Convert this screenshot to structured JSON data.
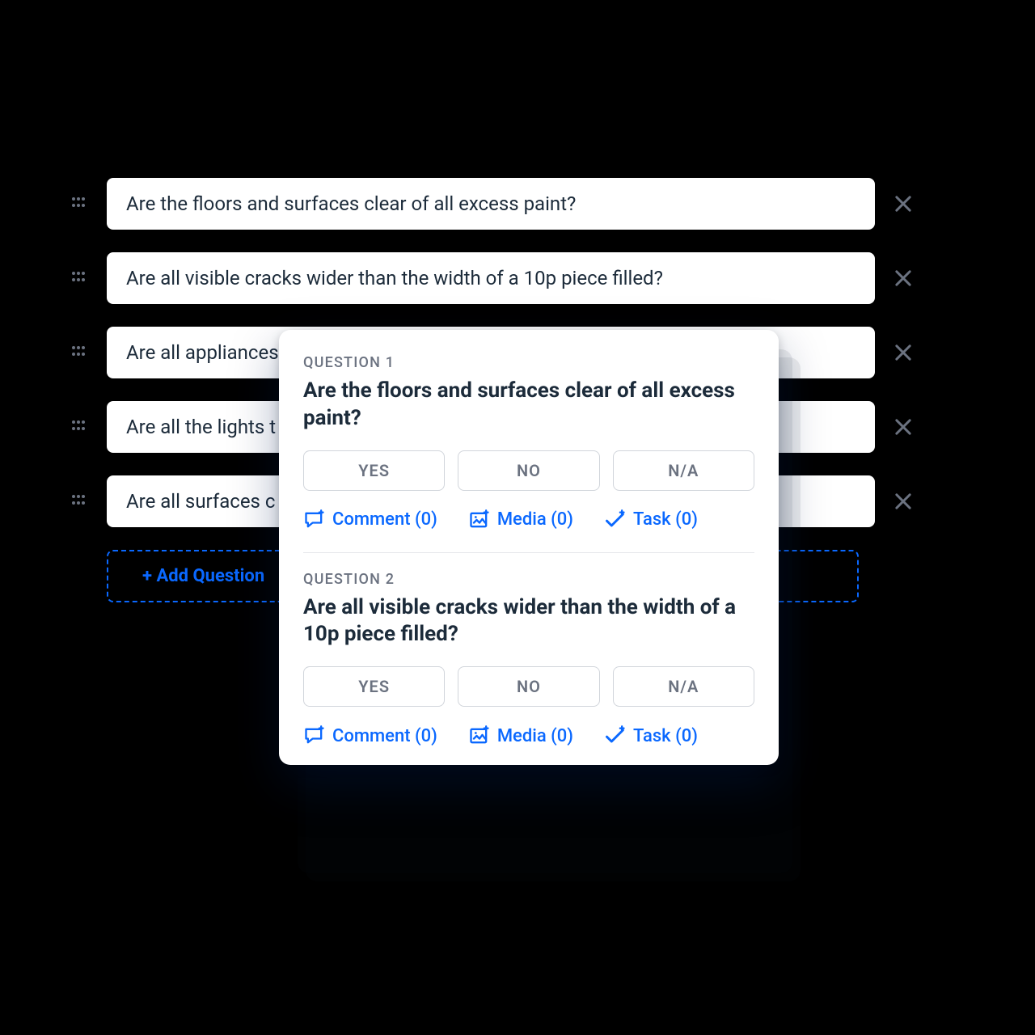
{
  "questions": [
    {
      "text": "Are the floors and surfaces clear of all excess paint?"
    },
    {
      "text": "Are all visible cracks wider than the width of a 10p piece filled?"
    },
    {
      "text": "Are all appliances"
    },
    {
      "text": "Are all the lights t"
    },
    {
      "text": "Are all surfaces c"
    }
  ],
  "add_button_label": "+ Add Question",
  "card": {
    "questions": [
      {
        "label": "QUESTION 1",
        "title": "Are the floors and surfaces clear of all excess paint?",
        "answers": {
          "yes": "YES",
          "no": "NO",
          "na": "N/A"
        },
        "actions": {
          "comment": "Comment (0)",
          "media": "Media (0)",
          "task": "Task (0)"
        }
      },
      {
        "label": "QUESTION 2",
        "title": "Are all visible cracks wider than the width of a 10p piece filled?",
        "answers": {
          "yes": "YES",
          "no": "NO",
          "na": "N/A"
        },
        "actions": {
          "comment": "Comment (0)",
          "media": "Media (0)",
          "task": "Task (0)"
        }
      }
    ]
  }
}
